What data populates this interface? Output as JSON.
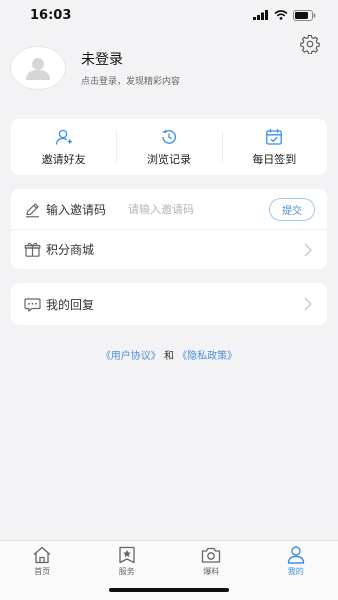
{
  "status": {
    "time": "16:03"
  },
  "profile": {
    "title": "未登录",
    "subtitle": "点击登录，发现精彩内容"
  },
  "quick_actions": [
    {
      "label": "邀请好友",
      "icon": "add-user-icon"
    },
    {
      "label": "浏览记录",
      "icon": "history-icon"
    },
    {
      "label": "每日签到",
      "icon": "calendar-check-icon"
    }
  ],
  "invite": {
    "label": "输入邀请码",
    "placeholder": "请输入邀请码",
    "submit_label": "提交"
  },
  "points_mall": {
    "label": "积分商城"
  },
  "replies": {
    "label": "我的回复"
  },
  "policy": {
    "user_agreement": "《用户协议》",
    "connector": "和",
    "privacy_policy": "《隐私政策》"
  },
  "tabbar": {
    "tabs": [
      {
        "label": "首页",
        "icon": "home-icon"
      },
      {
        "label": "服务",
        "icon": "service-icon"
      },
      {
        "label": "爆料",
        "icon": "camera-icon"
      },
      {
        "label": "我的",
        "icon": "user-icon"
      }
    ],
    "active": "我的"
  },
  "colors": {
    "accent": "#3a8ee6",
    "background": "#f3f3f5",
    "card": "#ffffff"
  }
}
